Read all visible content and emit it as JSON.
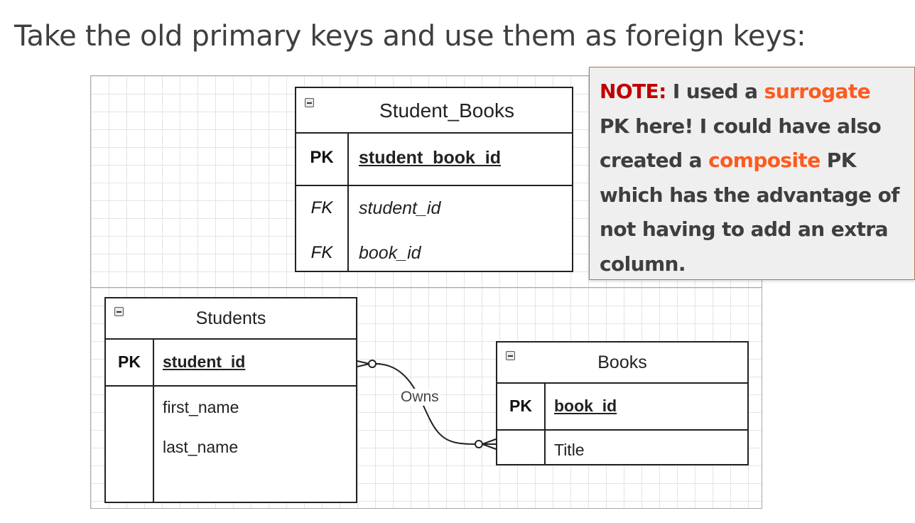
{
  "title": "Take the old primary keys and use them as foreign keys:",
  "colors": {
    "note_label": "#c00000",
    "highlight": "#ff5a1e",
    "note_background": "#efefef",
    "line": "#222222"
  },
  "note": {
    "label": "NOTE:",
    "text1": " I used a ",
    "highlight1": "surrogate",
    "text2": " PK here! I could have also created a ",
    "highlight2": "composite",
    "text3": " PK which has the advantage of not having to add an extra column."
  },
  "student_books": {
    "icon": "minus-icon",
    "name": "Student_Books",
    "pk_label": "PK",
    "pk_field": "student_book_id",
    "fk1_label": "FK",
    "fk1_field": "student_id",
    "fk2_label": "FK",
    "fk2_field": "book_id"
  },
  "students": {
    "icon": "minus-icon",
    "name": "Students",
    "pk_label": "PK",
    "pk_field": "student_id",
    "fields": [
      "first_name",
      "last_name"
    ]
  },
  "books": {
    "icon": "minus-icon",
    "name": "Books",
    "pk_label": "PK",
    "pk_field": "book_id",
    "fields": [
      "Title"
    ]
  },
  "relationship": {
    "label": "Owns",
    "cardinality_left": "zero-or-many",
    "cardinality_right": "zero-or-many"
  }
}
